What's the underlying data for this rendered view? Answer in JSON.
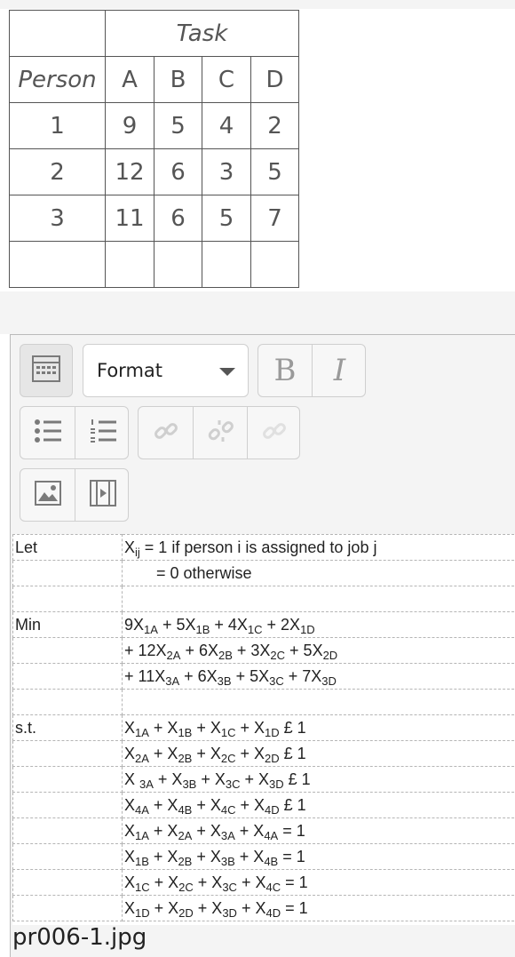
{
  "task_table": {
    "header_task": "Task",
    "header_person": "Person",
    "columns": [
      "A",
      "B",
      "C",
      "D"
    ],
    "rows": [
      {
        "person": "1",
        "values": [
          "9",
          "5",
          "4",
          "2"
        ]
      },
      {
        "person": "2",
        "values": [
          "12",
          "6",
          "3",
          "5"
        ]
      },
      {
        "person": "3",
        "values": [
          "11",
          "6",
          "5",
          "7"
        ]
      }
    ]
  },
  "toolbar": {
    "format_label": "Format",
    "bold_label": "B",
    "italic_label": "I",
    "icons": [
      "show-more-icon",
      "bullet-list-icon",
      "numbered-list-icon",
      "link-icon",
      "unlink-icon",
      "manage-files-icon",
      "image-icon",
      "media-icon"
    ]
  },
  "content": {
    "let_label": "Let",
    "let_line1": "X_ij = 1 if person i is assigned to job j",
    "let_line2": "= 0 otherwise",
    "min_label": "Min",
    "objective": [
      "9X1A + 5X1B + 4X1C + 2X1D",
      "+ 12X2A + 6X2B + 3X2C + 5X2D",
      "+ 11X3A + 6X3B + 5X3C + 7X3D"
    ],
    "st_label": "s.t.",
    "constraints": [
      "X1A + X1B + X1C + X1D £ 1",
      "X2A + X2B + X2C + X2D £ 1",
      "X 3A + X3B + X3C + X3D £ 1",
      "X4A + X4B + X4C + X4D £ 1",
      "X1A + X2A + X3A + X4A = 1",
      "X1B + X2B + X3B + X4B = 1",
      "X1C + X2C + X3C + X4C = 1",
      "X1D + X2D + X3D + X4D = 1"
    ]
  },
  "caption": "pr006-1.jpg",
  "colors": {
    "border": "#555555",
    "toolbar_bg": "#f4f4f4",
    "icon": "#9a9a9a"
  }
}
